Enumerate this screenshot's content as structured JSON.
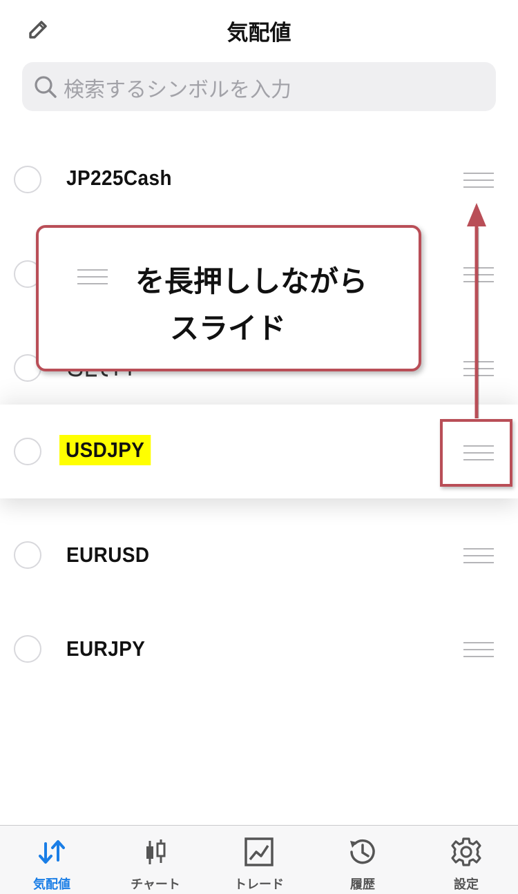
{
  "header": {
    "title": "気配値",
    "edit_icon": "pencil-icon"
  },
  "search": {
    "placeholder": "検索するシンボルを入力",
    "icon": "search-icon"
  },
  "symbols": [
    {
      "name": "JP225Cash"
    },
    {
      "name": ""
    },
    {
      "name": ""
    },
    {
      "name": "USDJPY",
      "highlighted": true
    },
    {
      "name": "EURUSD"
    },
    {
      "name": "EURJPY"
    }
  ],
  "callout": {
    "line1": "を長押ししながら",
    "line2": "スライド"
  },
  "tabs": [
    {
      "label": "気配値",
      "icon": "quotes-arrows-icon",
      "active": true
    },
    {
      "label": "チャート",
      "icon": "candlestick-icon",
      "active": false
    },
    {
      "label": "トレード",
      "icon": "trade-chart-icon",
      "active": false
    },
    {
      "label": "履歴",
      "icon": "history-icon",
      "active": false
    },
    {
      "label": "設定",
      "icon": "gear-icon",
      "active": false
    }
  ],
  "colors": {
    "accent": "#1a7ee6",
    "annotation": "#b94e57",
    "highlight": "#ffff00"
  }
}
